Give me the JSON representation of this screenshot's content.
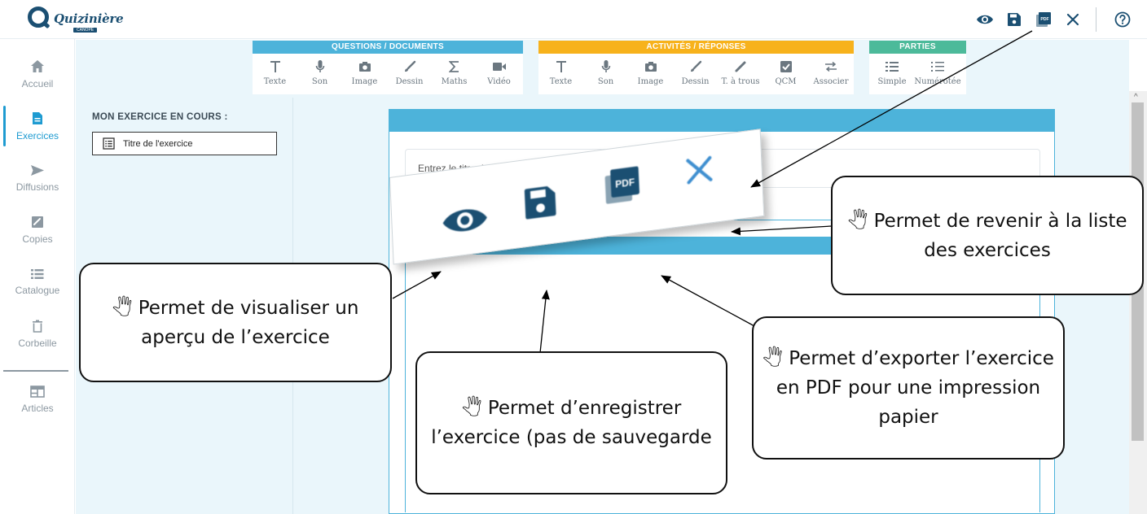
{
  "app": {
    "logo_text": "Quizinière",
    "logo_sub": "CANOPÉ"
  },
  "top_actions": [
    {
      "name": "preview-eye-icon"
    },
    {
      "name": "save-floppy-icon"
    },
    {
      "name": "pdf-export-icon"
    },
    {
      "name": "close-icon"
    },
    {
      "name": "help-icon"
    }
  ],
  "sidenav": {
    "items": [
      {
        "label": "Accueil",
        "icon": "home-icon",
        "active": false
      },
      {
        "label": "Exercices",
        "icon": "document-icon",
        "active": true
      },
      {
        "label": "Diffusions",
        "icon": "send-icon",
        "active": false
      },
      {
        "label": "Copies",
        "icon": "copy-icon",
        "active": false
      },
      {
        "label": "Catalogue",
        "icon": "list-icon",
        "active": false
      },
      {
        "label": "Corbeille",
        "icon": "trash-icon",
        "active": false
      },
      {
        "label": "Articles",
        "icon": "article-icon",
        "active": false
      }
    ]
  },
  "toolbar": {
    "groups": [
      {
        "title": "QUESTIONS / DOCUMENTS",
        "color": "#4db3da",
        "tools": [
          {
            "label": "Texte",
            "icon": "text-icon"
          },
          {
            "label": "Son",
            "icon": "microphone-icon"
          },
          {
            "label": "Image",
            "icon": "camera-icon"
          },
          {
            "label": "Dessin",
            "icon": "brush-icon"
          },
          {
            "label": "Maths",
            "icon": "sigma-icon"
          },
          {
            "label": "Vidéo",
            "icon": "video-icon"
          }
        ]
      },
      {
        "title": "ACTIVITÉS / RÉPONSES",
        "color": "#f7b21c",
        "tools": [
          {
            "label": "Texte",
            "icon": "text-icon"
          },
          {
            "label": "Son",
            "icon": "microphone-icon"
          },
          {
            "label": "Image",
            "icon": "camera-icon"
          },
          {
            "label": "Dessin",
            "icon": "brush-icon"
          },
          {
            "label": "T. à trous",
            "icon": "pencil-icon"
          },
          {
            "label": "QCM",
            "icon": "checkbox-icon"
          },
          {
            "label": "Associer",
            "icon": "swap-icon"
          }
        ]
      },
      {
        "title": "PARTIES",
        "color": "#4cba9a",
        "tools": [
          {
            "label": "Simple",
            "icon": "bullet-list-icon"
          },
          {
            "label": "Numérotée",
            "icon": "numbered-list-icon"
          }
        ]
      }
    ]
  },
  "left_panel": {
    "title": "MON EXERCICE EN COURS :",
    "item_label": "Titre de l'exercice"
  },
  "editor": {
    "title_placeholder": "Entrez le titre de l'exercice *"
  },
  "callouts": {
    "preview": "Permet de visualiser un aperçu de l’exercice",
    "save": "Permet d’enregistrer l’exercice (pas de sauvegarde",
    "pdf": "Permet d’exporter l’exercice en PDF pour une impression papier",
    "close": "Permet de revenir à la liste des exercices",
    "hand_glyph": "🖑"
  },
  "colors": {
    "accent": "#1e9bd1",
    "dark_blue": "#1b4f72",
    "questions": "#4db3da",
    "activities": "#f7b21c",
    "parts": "#4cba9a"
  }
}
